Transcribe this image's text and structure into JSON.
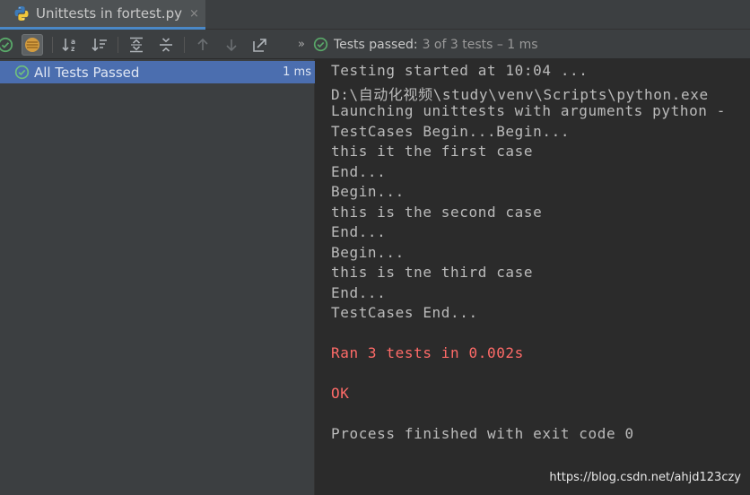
{
  "tab": {
    "title": "Unittests in fortest.py",
    "close": "×"
  },
  "toolbar": {
    "buttons": [
      "show-passed",
      "show-ignored",
      "sort-alphabetically",
      "sort-by-duration",
      "expand-all",
      "collapse-all",
      "previous-failed",
      "next-failed",
      "export"
    ]
  },
  "status": {
    "chevron": "»",
    "label": "Tests passed:",
    "count": "3 of 3 tests – 1 ms"
  },
  "tree": {
    "root_label": "All Tests Passed",
    "root_time": "1 ms"
  },
  "console": {
    "lines": [
      "Testing started at 10:04 ...",
      "D:\\自动化视频\\study\\venv\\Scripts\\python.exe",
      "Launching unittests with arguments python -",
      "TestCases Begin...Begin...",
      "this it the first case",
      "End...",
      "Begin...",
      "this is the second case",
      "End...",
      "Begin...",
      "this is tne third case",
      "End...",
      "TestCases End...",
      "",
      "Ran 3 tests in 0.002s",
      "",
      "OK",
      "",
      "Process finished with exit code 0"
    ],
    "error_color": "#ff6b68",
    "text_color": "#bbbbbb"
  },
  "watermark": "https://blog.csdn.net/ahjd123czy",
  "colors": {
    "accent_selection": "#4b6eaf",
    "pass_green": "#59a869",
    "panel_bg": "#3c3f41",
    "console_bg": "#2b2b2b"
  }
}
